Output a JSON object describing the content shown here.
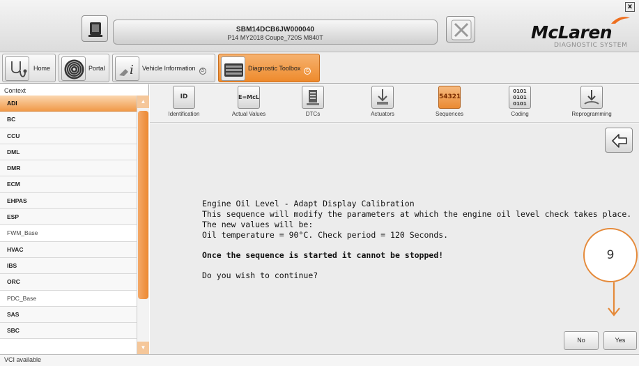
{
  "header": {
    "close_label": "x",
    "vin": "SBM14DCB6JW000040",
    "model": "P14 MY2018 Coupe_720S M840T",
    "logo_text": "McLaren",
    "logo_subtitle": "DIAGNOSTIC SYSTEM"
  },
  "nav": {
    "tabs": [
      {
        "label": "Home",
        "icon": "stethoscope-icon"
      },
      {
        "label": "Portal",
        "icon": "portal-swirl-icon"
      },
      {
        "label": "Vehicle Information",
        "icon": "vehicle-info-icon"
      },
      {
        "label": "Diagnostic Toolbox",
        "icon": "toolbox-icon",
        "active": true
      }
    ]
  },
  "context": {
    "title": "Context",
    "items": [
      "ADI",
      "BC",
      "CCU",
      "DML",
      "DMR",
      "ECM",
      "EHPAS",
      "ESP",
      "FWM_Base",
      "HVAC",
      "IBS",
      "ORC",
      "PDC_Base",
      "SAS",
      "SBC"
    ],
    "selected": "ADI"
  },
  "toolbar": {
    "tools": [
      {
        "label": "Identification",
        "icon": "id-icon",
        "glyph": "ID"
      },
      {
        "label": "Actual Values",
        "icon": "actual-values-icon",
        "glyph": "E=McL"
      },
      {
        "label": "DTCs",
        "icon": "dtcs-icon",
        "glyph": ""
      },
      {
        "label": "Actuators",
        "icon": "actuators-icon",
        "glyph": ""
      },
      {
        "label": "Sequences",
        "icon": "sequences-icon",
        "glyph": "54321",
        "active": true
      },
      {
        "label": "Coding",
        "icon": "coding-icon",
        "glyph": "0101"
      },
      {
        "label": "Reprogramming",
        "icon": "reprogramming-icon",
        "glyph": ""
      }
    ]
  },
  "main": {
    "title": "Engine Oil Level - Adapt Display Calibration",
    "line1": "This sequence will modify the parameters at which the engine oil level check takes place.",
    "line2": "The new values will be:",
    "line3": "Oil temperature = 90°C. Check period = 120 Seconds.",
    "warning": "Once the sequence is started it cannot be stopped!",
    "question": "Do you wish to continue?",
    "step_number": "9",
    "no_label": "No",
    "yes_label": "Yes"
  },
  "status": {
    "text": "VCI available"
  },
  "colors": {
    "accent_orange": "#ee8a2c",
    "annotation_orange": "#e58a3a"
  }
}
